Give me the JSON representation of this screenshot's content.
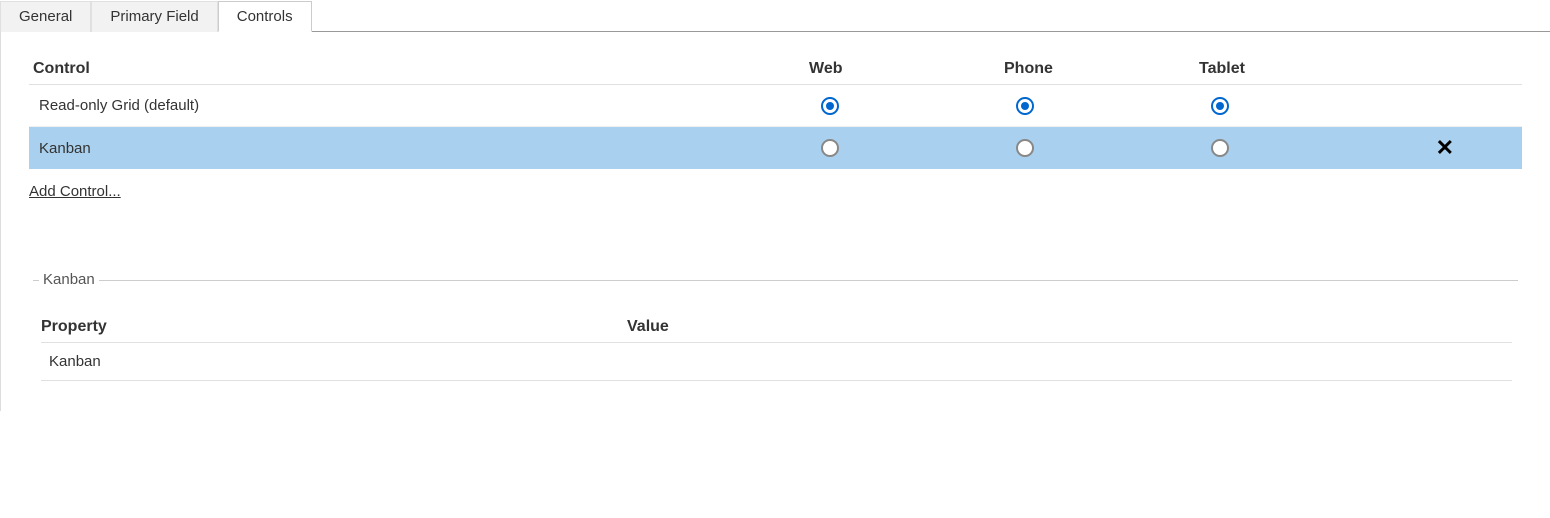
{
  "tabs": {
    "general": "General",
    "primary_field": "Primary Field",
    "controls": "Controls"
  },
  "controls_table": {
    "headers": {
      "control": "Control",
      "web": "Web",
      "phone": "Phone",
      "tablet": "Tablet"
    },
    "rows": [
      {
        "name": "Read-only Grid (default)",
        "web_checked": true,
        "phone_checked": true,
        "tablet_checked": true,
        "selected": false,
        "removable": false
      },
      {
        "name": "Kanban",
        "web_checked": false,
        "phone_checked": false,
        "tablet_checked": false,
        "selected": true,
        "removable": true
      }
    ],
    "add_control_link": "Add Control..."
  },
  "details": {
    "legend": "Kanban",
    "headers": {
      "property": "Property",
      "value": "Value"
    },
    "rows": [
      {
        "property": "Kanban",
        "value": ""
      }
    ]
  }
}
